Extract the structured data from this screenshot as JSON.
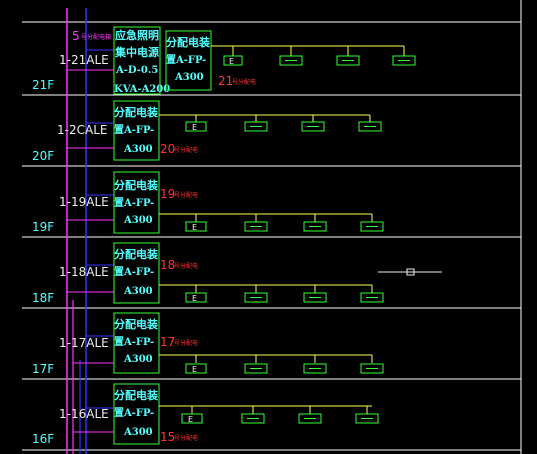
{
  "colors": {
    "background": "#000000",
    "floor_line": "#ffffff",
    "cyan": "#55ffff",
    "green": "#33ff33",
    "yellow": "#ffff55",
    "red": "#ff3333",
    "magenta": "#ff33ff",
    "blue": "#3333ff"
  },
  "top_label": "5",
  "top_label_small": "号分配电箱",
  "emergency_box": [
    "应急照明",
    "集中电源",
    "A-D-0.5",
    "KVA-A200"
  ],
  "floors": [
    {
      "floor": "21F",
      "ale": "1-21ALE",
      "box": [
        "分配电装",
        "置A-FP-",
        "A300"
      ],
      "note_num": "21",
      "note_small": "号分配电",
      "circuits": [
        "E",
        "",
        "",
        "",
        ""
      ]
    },
    {
      "floor": "20F",
      "ale": "1-2CALE",
      "box": [
        "分配电装",
        "置A-FP-",
        "A300"
      ],
      "note_num": "20",
      "note_small": "号分配电",
      "circuits": [
        "E",
        "",
        "",
        ""
      ]
    },
    {
      "floor": "19F",
      "ale": "1-19ALE",
      "box": [
        "分配电装",
        "置A-FP-",
        "A300"
      ],
      "note_num": "19",
      "note_small": "号分配电",
      "circuits": [
        "E",
        "",
        "",
        "",
        ""
      ]
    },
    {
      "floor": "18F",
      "ale": "1-18ALE",
      "box": [
        "分配电装",
        "置A-FP-",
        "A300"
      ],
      "note_num": "18",
      "note_small": "号分配电",
      "circuits": [
        "E",
        "",
        "",
        "",
        ""
      ]
    },
    {
      "floor": "17F",
      "ale": "1-17ALE",
      "box": [
        "分配电装",
        "置A-FP-",
        "A300"
      ],
      "note_num": "17",
      "note_small": "号分配电",
      "circuits": [
        "E",
        "",
        "",
        "",
        ""
      ]
    },
    {
      "floor": "16F",
      "ale": "1-16ALE",
      "box": [
        "分配电装",
        "置A-FP-",
        "A300"
      ],
      "note_num": "15",
      "note_small": "号分配电",
      "circuits": [
        "E",
        "",
        "",
        ""
      ]
    }
  ]
}
